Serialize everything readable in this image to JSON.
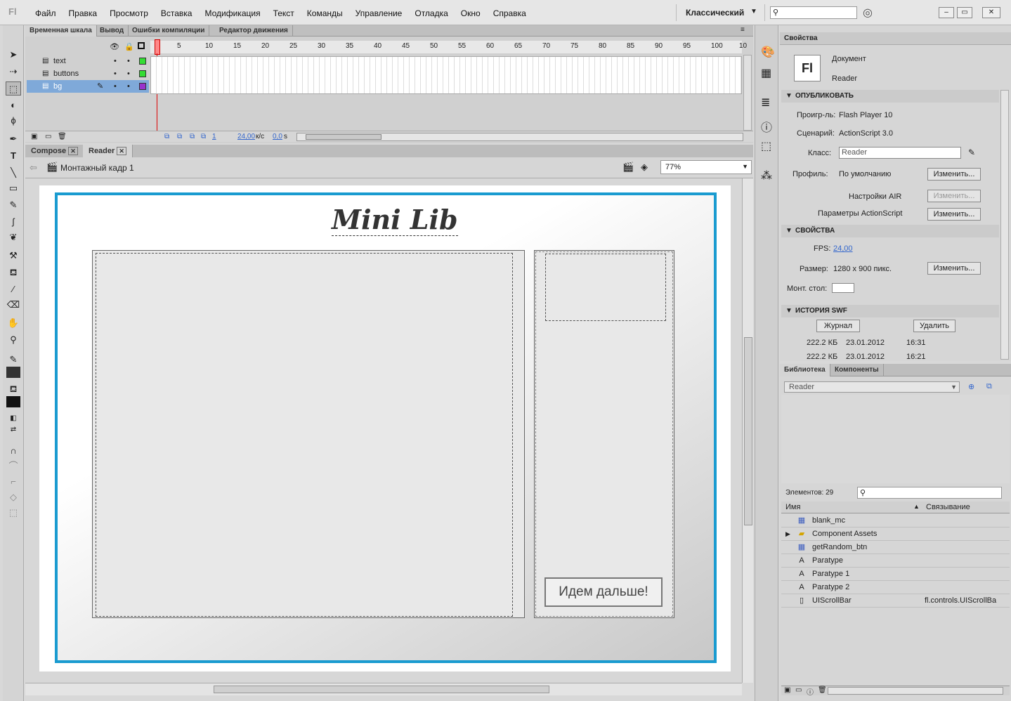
{
  "app": {
    "logo": "Fl",
    "menus": [
      "Файл",
      "Правка",
      "Просмотр",
      "Вставка",
      "Модификация",
      "Текст",
      "Команды",
      "Управление",
      "Отладка",
      "Окно",
      "Справка"
    ],
    "workspace": "Классический"
  },
  "timeline": {
    "tabs": [
      "Временная шкала",
      "Вывод",
      "Ошибки компиляции",
      "Редактор движения"
    ],
    "ruler": [
      "1",
      "5",
      "10",
      "15",
      "20",
      "25",
      "30",
      "35",
      "40",
      "45",
      "50",
      "55",
      "60",
      "65",
      "70",
      "75",
      "80",
      "85",
      "90",
      "95",
      "100",
      "10"
    ],
    "layers": [
      {
        "name": "text",
        "color": "#33dd33"
      },
      {
        "name": "buttons",
        "color": "#33dd33"
      },
      {
        "name": "bg",
        "color": "#9933cc"
      }
    ],
    "status": {
      "frame": "1",
      "fps": "24,00",
      "fps_unit": "к/с",
      "time": "0,0",
      "time_unit": "s"
    }
  },
  "documents": {
    "tabs": [
      "Compose",
      "Reader"
    ],
    "active": "Reader",
    "scene": "Монтажный кадр 1",
    "zoom": "77%"
  },
  "stage": {
    "title": "Mini Lib",
    "button": "Идем дальше!"
  },
  "properties": {
    "tab": "Свойства",
    "doc_type": "Документ",
    "doc_name": "Reader",
    "fl_icon": "Fl",
    "sections": {
      "publish": "ОПУБЛИКОВАТЬ",
      "props": "СВОЙСТВА",
      "history": "ИСТОРИЯ SWF"
    },
    "player_label": "Проигр-ль:",
    "player": "Flash Player 10",
    "script_label": "Сценарий:",
    "script": "ActionScript 3.0",
    "class_label": "Класс:",
    "class_value": "Reader",
    "profile_label": "Профиль:",
    "profile": "По умолчанию",
    "change": "Изменить...",
    "air": "Настройки AIR",
    "as_params": "Параметры ActionScript",
    "fps_label": "FPS:",
    "fps": "24,00",
    "size_label": "Размер:",
    "size": "1280 x 900 пикс.",
    "stage_label": "Монт. стол:",
    "journal": "Журнал",
    "delete": "Удалить",
    "history": [
      {
        "size": "222.2 КБ",
        "date": "23.01.2012",
        "time": "16:31"
      },
      {
        "size": "222.2 КБ",
        "date": "23.01.2012",
        "time": "16:21"
      }
    ]
  },
  "library": {
    "tabs": [
      "Библиотека",
      "Компоненты"
    ],
    "document": "Reader",
    "count_label": "Элементов: 29",
    "col_name": "Имя",
    "col_link": "Связывание",
    "items": [
      {
        "name": "blank_mc",
        "icon": "movieclip-icon",
        "glyph": "▦",
        "link": ""
      },
      {
        "name": "Component Assets",
        "icon": "folder-icon",
        "glyph": "▰",
        "link": ""
      },
      {
        "name": "getRandom_btn",
        "icon": "button-symbol-icon",
        "glyph": "▦",
        "link": ""
      },
      {
        "name": "Paratype",
        "icon": "font-icon",
        "glyph": "A",
        "link": ""
      },
      {
        "name": "Paratype 1",
        "icon": "font-icon",
        "glyph": "A",
        "link": ""
      },
      {
        "name": "Paratype 2",
        "icon": "font-icon",
        "glyph": "A",
        "link": ""
      },
      {
        "name": "UIScrollBar",
        "icon": "component-icon",
        "glyph": "▯",
        "link": "fl.controls.UIScrollBa"
      }
    ]
  }
}
